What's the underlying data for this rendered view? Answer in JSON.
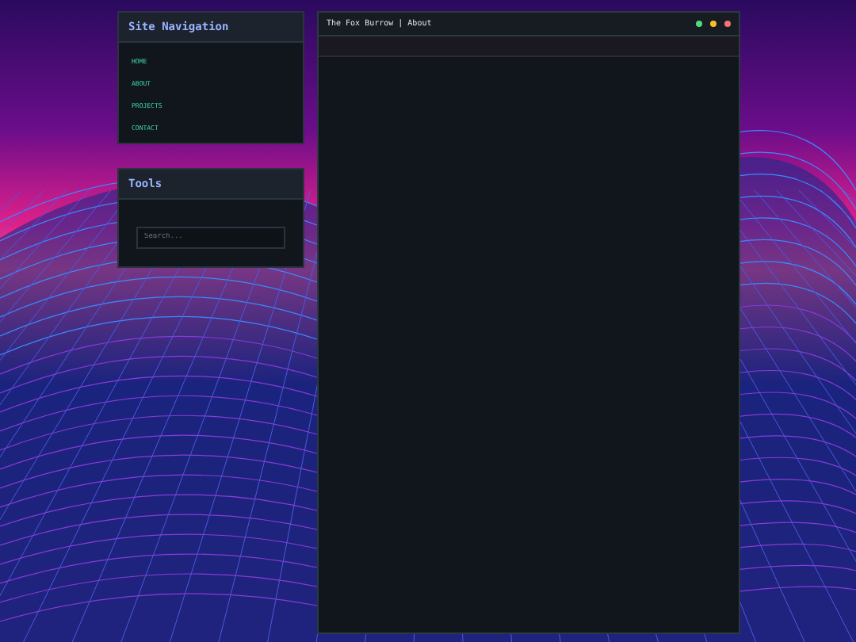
{
  "navigation": {
    "title": "Site Navigation",
    "items": [
      {
        "label": "HOME"
      },
      {
        "label": "ABOUT"
      },
      {
        "label": "PROJECTS"
      },
      {
        "label": "CONTACT"
      }
    ]
  },
  "tools": {
    "title": "Tools",
    "search": {
      "placeholder": "Search..."
    }
  },
  "window": {
    "title": "The Fox Burrow | About",
    "dots": [
      {
        "color": "#4ade80"
      },
      {
        "color": "#fbbf24"
      },
      {
        "color": "#f87171"
      }
    ]
  }
}
